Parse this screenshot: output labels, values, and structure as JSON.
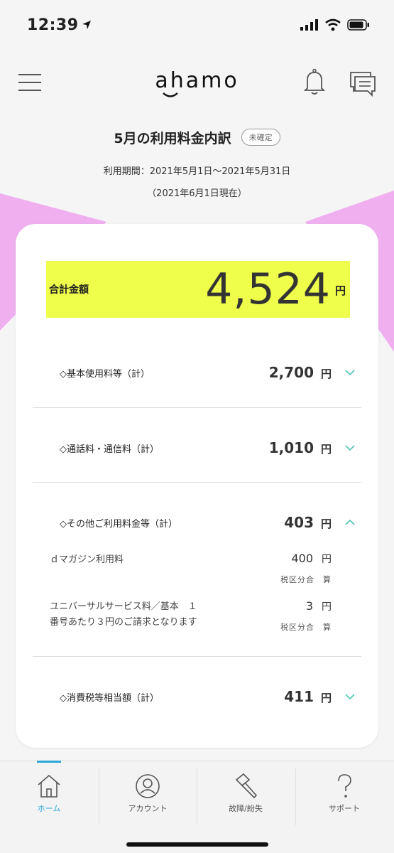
{
  "status_bar": {
    "time": "12:39"
  },
  "header": {
    "logo_text": "ahamo"
  },
  "page": {
    "title": "5月の利用料金内訳",
    "badge": "未確定",
    "period": "利用期間：2021年5月1日〜2021年5月31日",
    "as_of": "（2021年6月1日現在）"
  },
  "total": {
    "label": "合計金額",
    "value": "4,524",
    "unit": "円"
  },
  "rows": [
    {
      "label": "◇基本使用料等（計）",
      "amount": "2,700",
      "unit": "円"
    },
    {
      "label": "◇通話料・通信料（計）",
      "amount": "1,010",
      "unit": "円"
    },
    {
      "label": "◇その他ご利用料金等（計）",
      "amount": "403",
      "unit": "円"
    },
    {
      "label": "◇消費税等相当額（計）",
      "amount": "411",
      "unit": "円"
    }
  ],
  "sub_items": [
    {
      "label_line1": "ｄマガジン利用料",
      "label_line2": "",
      "amount": "400",
      "unit": "円",
      "tax": "税区分合　算"
    },
    {
      "label_line1": "ユニバーサルサービス料／基本　１",
      "label_line2": "番号あたり３円のご請求となります",
      "amount": "3",
      "unit": "円",
      "tax": "税区分合　算"
    }
  ],
  "tabs": [
    {
      "label": "ホーム"
    },
    {
      "label": "アカウント"
    },
    {
      "label": "故障/紛失"
    },
    {
      "label": "サポート"
    }
  ],
  "colors": {
    "accent": "#2ca7d8",
    "highlight": "#eefe4a",
    "pink": "#f0b0f0",
    "teal": "#4fc3b3"
  }
}
